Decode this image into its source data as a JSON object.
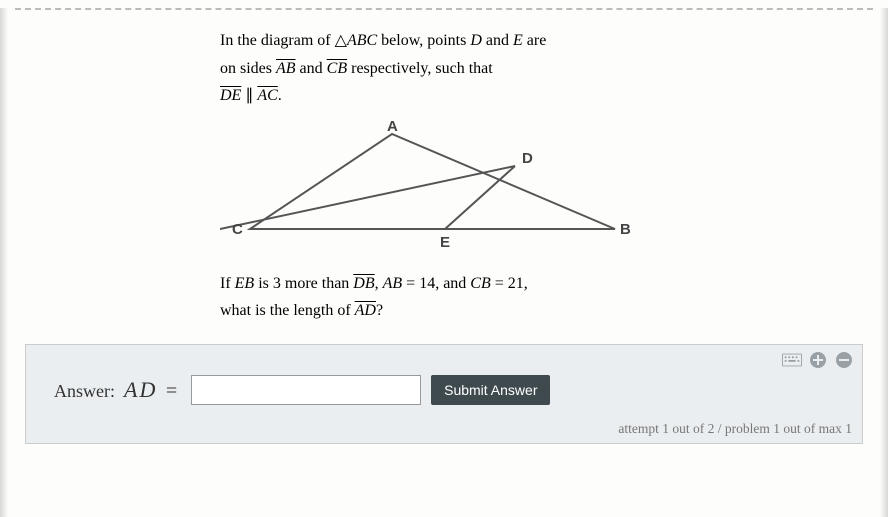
{
  "problem": {
    "intro_pre": "In the diagram of ",
    "triangle_sym": "△",
    "triangle_name": "ABC",
    "intro_mid": " below, points ",
    "point_D": "D",
    "intro_and": " and ",
    "point_E": "E",
    "intro_post": " are",
    "line2_pre": "on sides ",
    "seg_AB": "AB",
    "line2_and": " and ",
    "seg_CB": "CB",
    "line2_post": " respectively, such that",
    "seg_DE": "DE",
    "parallel_sym": " ∥ ",
    "seg_AC": "AC",
    "period": ".",
    "q_pre": "If ",
    "q_EB": "EB",
    "q_mid1": " is 3 more than ",
    "q_DB": "DB",
    "q_mid2": ", ",
    "q_AB": "AB",
    "q_eq14": " = 14, and ",
    "q_CB": "CB",
    "q_eq21": " = 21,",
    "q_line2_pre": "what is the length of ",
    "q_AD": "AD",
    "q_qmark": "?"
  },
  "diagram": {
    "labels": {
      "A": "A",
      "B": "B",
      "C": "C",
      "D": "D",
      "E": "E"
    }
  },
  "answer": {
    "label_word": "Answer:",
    "var_name": "AD",
    "equals": "=",
    "input_value": "",
    "submit_label": "Submit Answer"
  },
  "status": {
    "attempt_text": "attempt 1 out of 2 / problem 1 out of max 1"
  }
}
